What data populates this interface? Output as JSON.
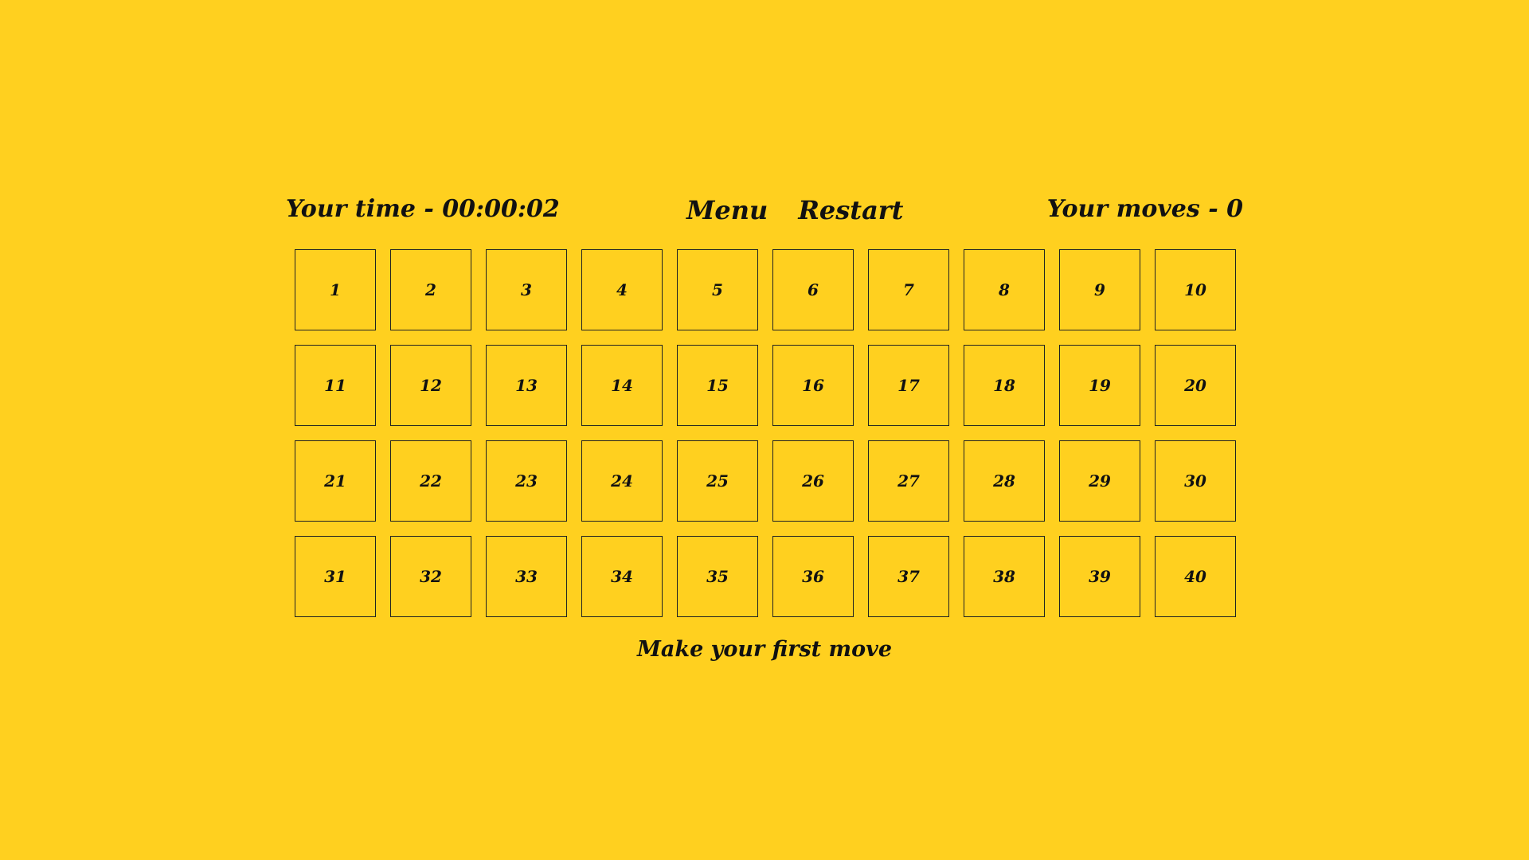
{
  "header": {
    "time_label": "Your time - 00:00:02",
    "menu_label": "Menu",
    "restart_label": "Restart",
    "moves_label": "Your moves - 0"
  },
  "board": {
    "cells": [
      "1",
      "2",
      "3",
      "4",
      "5",
      "6",
      "7",
      "8",
      "9",
      "10",
      "11",
      "12",
      "13",
      "14",
      "15",
      "16",
      "17",
      "18",
      "19",
      "20",
      "21",
      "22",
      "23",
      "24",
      "25",
      "26",
      "27",
      "28",
      "29",
      "30",
      "31",
      "32",
      "33",
      "34",
      "35",
      "36",
      "37",
      "38",
      "39",
      "40"
    ]
  },
  "status": {
    "message": "Make your first move"
  },
  "colors": {
    "background": "#FFD01F",
    "text": "#111111",
    "cell_border": "#222222"
  }
}
